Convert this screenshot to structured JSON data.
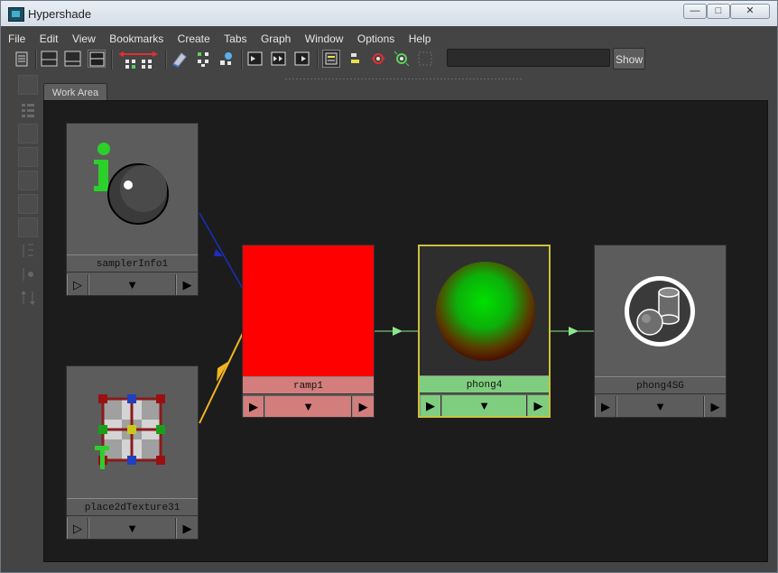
{
  "window": {
    "title": "Hypershade"
  },
  "menu": [
    "File",
    "Edit",
    "View",
    "Bookmarks",
    "Create",
    "Tabs",
    "Graph",
    "Window",
    "Options",
    "Help"
  ],
  "toolbar": {
    "search_value": "",
    "show_label": "Show"
  },
  "tabs": [
    {
      "label": "Work Area"
    }
  ],
  "nodes": {
    "samplerInfo1": {
      "label": "samplerInfo1",
      "icon": "sampler-info-icon"
    },
    "place2dTexture31": {
      "label": "place2dTexture31",
      "icon": "place2d-texture-icon"
    },
    "ramp1": {
      "label": "ramp1",
      "swatch_color": "#ff0000",
      "label_color": "#d47d7d"
    },
    "phong4": {
      "label": "phong4",
      "swatch": "green-red sphere",
      "label_color": "#7fce7f",
      "selected_outline": "#c8c23a"
    },
    "phong4SG": {
      "label": "phong4SG",
      "icon": "shading-group-icon"
    }
  },
  "connections": [
    {
      "from": "samplerInfo1",
      "to": "ramp1",
      "color": "#1a2fbf"
    },
    {
      "from": "place2dTexture31",
      "to": "ramp1",
      "color": "#f2b51e"
    },
    {
      "from": "ramp1",
      "to": "phong4",
      "color": "#8de68d"
    },
    {
      "from": "phong4",
      "to": "phong4SG",
      "color": "#8de68d"
    }
  ]
}
